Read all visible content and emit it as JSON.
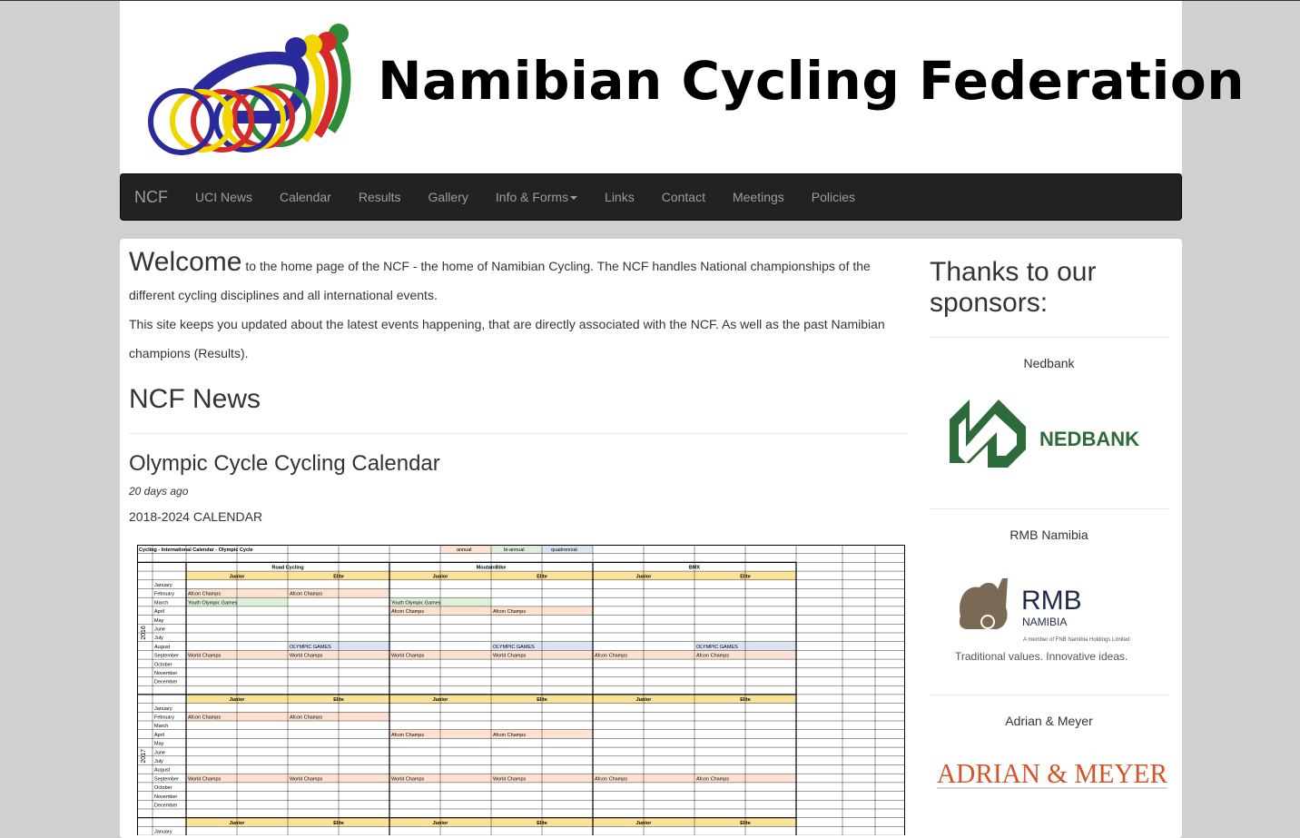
{
  "header": {
    "title": "Namibian Cycling Federation"
  },
  "nav": {
    "brand": "NCF",
    "items": [
      {
        "label": "UCI News"
      },
      {
        "label": "Calendar"
      },
      {
        "label": "Results"
      },
      {
        "label": "Gallery"
      },
      {
        "label": "Info & Forms",
        "dropdown": true
      },
      {
        "label": "Links"
      },
      {
        "label": "Contact"
      },
      {
        "label": "Meetings"
      },
      {
        "label": "Policies"
      }
    ]
  },
  "intro": {
    "welcome": "Welcome",
    "text1": " to the home page of the NCF - the home of Namibian Cycling. The NCF handles National championships of the different cycling disciplines and all international events.",
    "text2": "This site keeps you updated about the latest events happening, that are directly associated with the NCF. As well as the past Namibian champions (Results)."
  },
  "news": {
    "heading": "NCF News",
    "post": {
      "title": "Olympic Cycle Cycling Calendar",
      "date": "20 days ago",
      "body": "2018-2024 CALENDAR"
    }
  },
  "calendar_image": {
    "title": "Cycling - International Calendar - Olympic Cycle",
    "legend": [
      "annual",
      "bi-annual",
      "quadrennial"
    ],
    "disciplines": [
      "Road Cycling",
      "MoutainBike",
      "BMX"
    ],
    "levels": [
      "Junior",
      "Elite"
    ],
    "years": [
      "2016",
      "2017"
    ],
    "months": [
      "January",
      "February",
      "March",
      "April",
      "May",
      "June",
      "July",
      "August",
      "September",
      "October",
      "November",
      "December"
    ],
    "events": {
      "afcon": "Afcon Champs",
      "youth": "Youth Olympic Games",
      "olympic": "OLYMPIC GAMES",
      "world": "World Champs"
    }
  },
  "sidebar": {
    "heading": "Thanks to our sponsors:",
    "sponsors": [
      {
        "name": "Nedbank",
        "logo_text": "NEDBANK"
      },
      {
        "name": "RMB Namibia",
        "logo_text": "RMB",
        "logo_sub": "NAMIBIA",
        "logo_note": "A member of FNB Namibia Holdings Limited",
        "tagline": "Traditional values. Innovative ideas."
      },
      {
        "name": "Adrian & Meyer",
        "logo_text": "ADRIAN & MEYER"
      }
    ]
  },
  "colors": {
    "nav_bg": "#222222",
    "nav_text": "#9d9d9d",
    "nedbank_green": "#2e6b3a",
    "rmb_navy": "#1f2a4d",
    "am_orange": "#d4542a"
  }
}
